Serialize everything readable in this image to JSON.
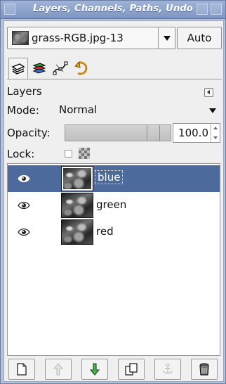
{
  "window": {
    "title": "Layers, Channels, Paths, Undo"
  },
  "image_selector": {
    "value": "grass-RGB.jpg-13",
    "auto_label": "Auto"
  },
  "tabs": [
    {
      "icon": "layers-icon",
      "active": true
    },
    {
      "icon": "channels-icon",
      "active": false
    },
    {
      "icon": "paths-icon",
      "active": false
    },
    {
      "icon": "undo-history-icon",
      "active": false
    }
  ],
  "layers_panel": {
    "title": "Layers",
    "mode_label": "Mode:",
    "mode_value": "Normal",
    "opacity_label": "Opacity:",
    "opacity_value": "100.0",
    "opacity_fraction": 1.0,
    "lock_label": "Lock:"
  },
  "layers": [
    {
      "name": "blue",
      "visible": true,
      "selected": true
    },
    {
      "name": "green",
      "visible": true,
      "selected": false
    },
    {
      "name": "red",
      "visible": true,
      "selected": false
    }
  ],
  "bottom_buttons": [
    {
      "icon": "new-layer-icon",
      "enabled": true
    },
    {
      "icon": "raise-layer-icon",
      "enabled": false
    },
    {
      "icon": "lower-layer-icon",
      "enabled": true
    },
    {
      "icon": "duplicate-layer-icon",
      "enabled": true
    },
    {
      "icon": "anchor-layer-icon",
      "enabled": false
    },
    {
      "icon": "delete-layer-icon",
      "enabled": true
    }
  ],
  "colors": {
    "selection": "#4d6a9c",
    "titlebar": "#8aa0c9",
    "raise_arrow_disabled": "#9aa89a",
    "lower_arrow": "#2e7d32"
  }
}
